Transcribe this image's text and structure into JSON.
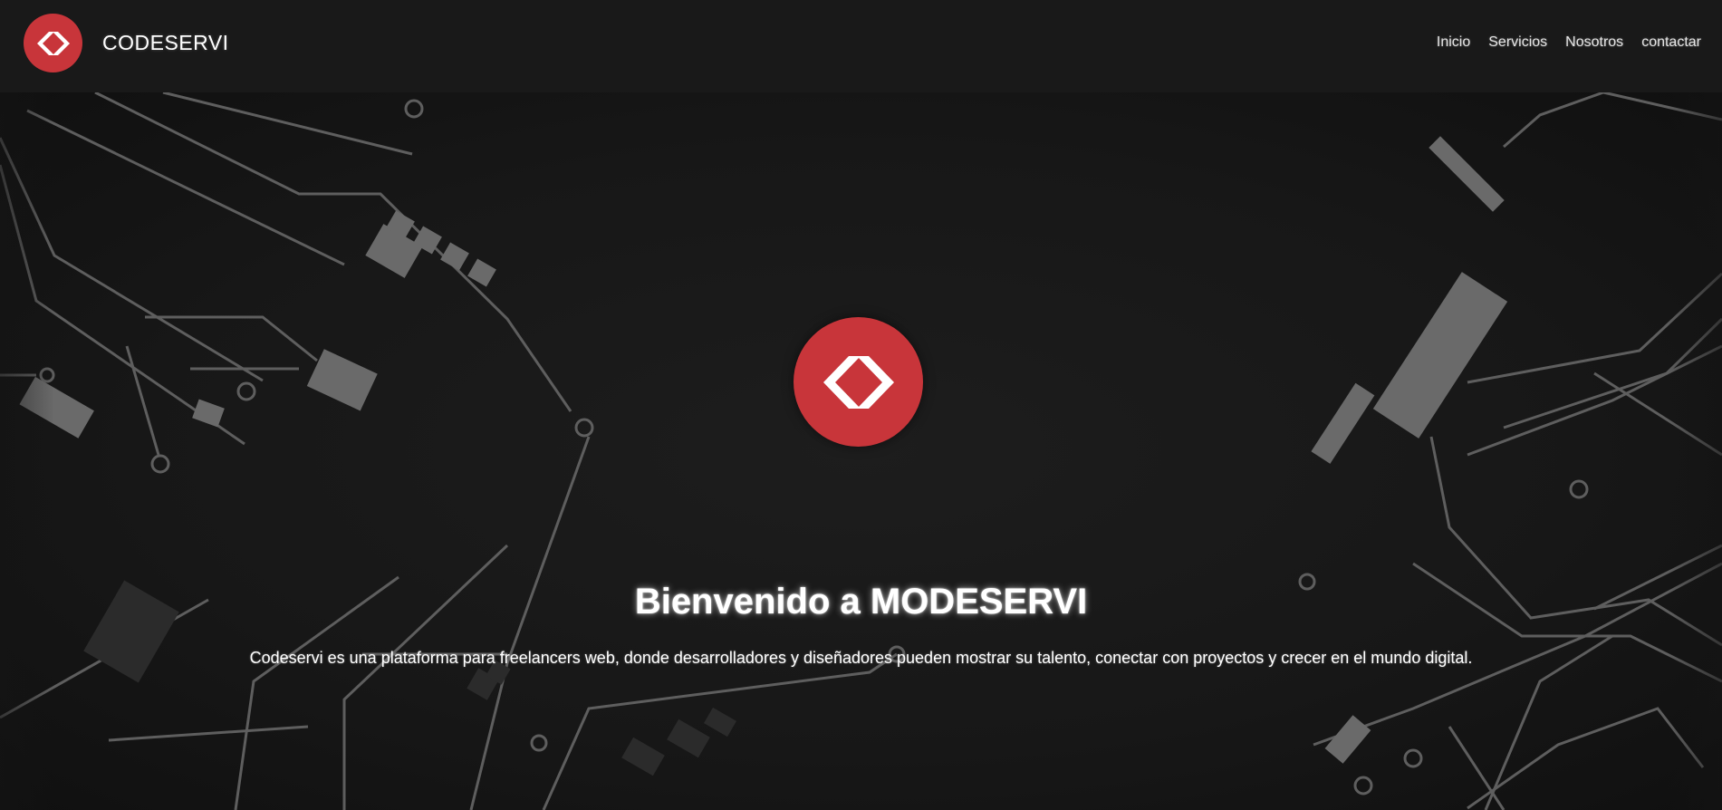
{
  "header": {
    "brand_name": "CODESERVI",
    "logo_icon": "code-brackets-icon",
    "nav": [
      {
        "label": "Inicio"
      },
      {
        "label": "Servicios"
      },
      {
        "label": "Nosotros"
      },
      {
        "label": "contactar"
      }
    ]
  },
  "hero": {
    "logo_icon": "code-brackets-icon",
    "title": "Bienvenido a MODESERVI",
    "description": "Codeservi es una plataforma para freelancers web, donde desarrolladores y diseñadores pueden mostrar su talento, conectar con proyectos y crecer en el mundo digital.",
    "background": "circuit-board-pattern"
  },
  "colors": {
    "brand_red": "#c8353a",
    "navbar_bg": "#191919",
    "hero_bg": "#171717",
    "text": "#ffffff"
  }
}
